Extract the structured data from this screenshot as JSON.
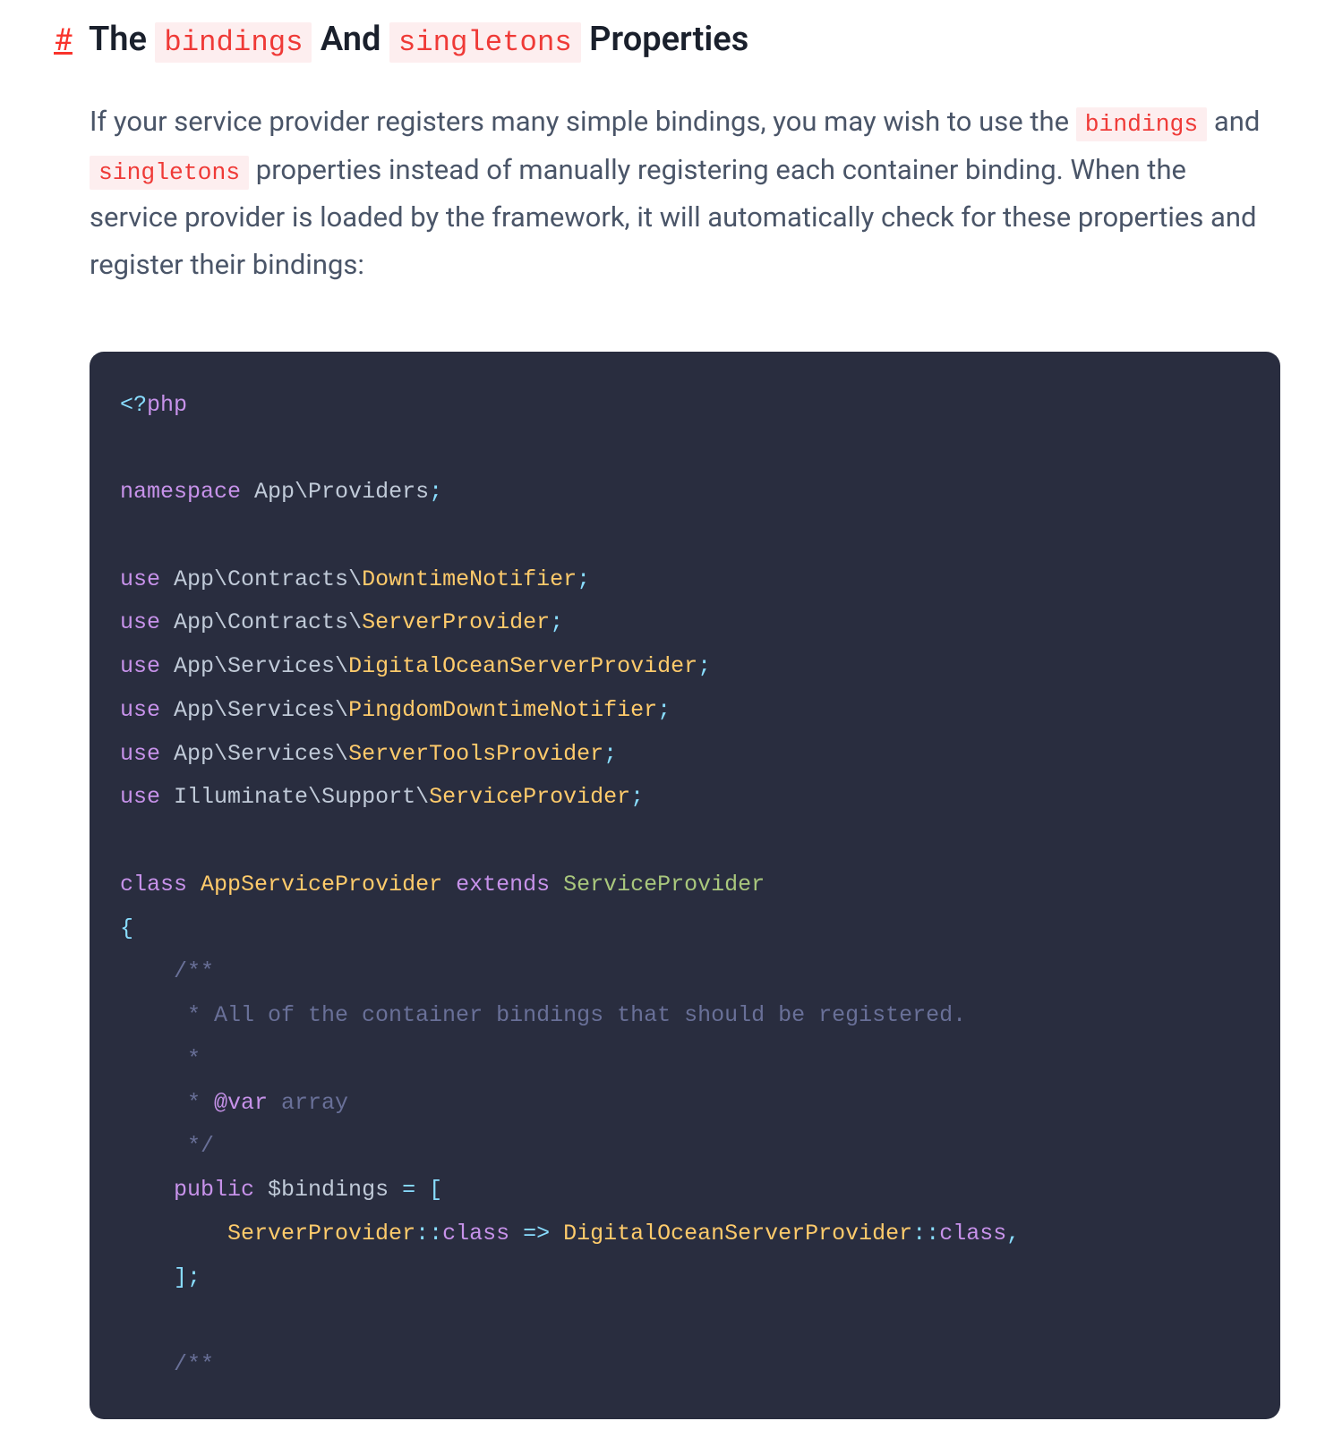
{
  "heading": {
    "part1": "The ",
    "code1": "bindings",
    "part2": " And ",
    "code2": "singletons",
    "part3": " Properties"
  },
  "paragraph": {
    "t1": "If your service provider registers many simple bindings, you may wish to use the ",
    "c1": "bindings",
    "t2": " and ",
    "c2": "singletons",
    "t3": " properties instead of manually registering each container binding. When the service provider is loaded by the framework, it will automatically check for these properties and register their bindings:"
  },
  "code": {
    "l01_open": "<?",
    "l01_php": "php",
    "l02_kw": "namespace",
    "l02_ns": "App\\Providers",
    "l03_kw": "use",
    "l03_ns": "App\\Contracts\\",
    "l03_cls": "DowntimeNotifier",
    "l04_kw": "use",
    "l04_ns": "App\\Contracts\\",
    "l04_cls": "ServerProvider",
    "l05_kw": "use",
    "l05_ns": "App\\Services\\",
    "l05_cls": "DigitalOceanServerProvider",
    "l06_kw": "use",
    "l06_ns": "App\\Services\\",
    "l06_cls": "PingdomDowntimeNotifier",
    "l07_kw": "use",
    "l07_ns": "App\\Services\\",
    "l07_cls": "ServerToolsProvider",
    "l08_kw": "use",
    "l08_ns": "Illuminate\\Support\\",
    "l08_cls": "ServiceProvider",
    "l09_kw1": "class",
    "l09_cls": "AppServiceProvider",
    "l09_kw2": "extends",
    "l09_ext": "ServiceProvider",
    "doc1_a": "/**",
    "doc1_b": "     * All of the container bindings that should be registered.",
    "doc1_c": "     *",
    "doc1_d": "     * ",
    "doc1_d_tag": "@var",
    "doc1_d_type": " array",
    "doc1_e": "     */",
    "l15_kw": "public",
    "l15_var": "$bindings",
    "l15_eq": " = [",
    "l16_a": "ServerProvider",
    "l16_scope": "::",
    "l16_class": "class",
    "l16_arrow": " => ",
    "l16_b": "DigitalOceanServerProvider",
    "l17": "    ];",
    "doc2_a": "/**"
  }
}
